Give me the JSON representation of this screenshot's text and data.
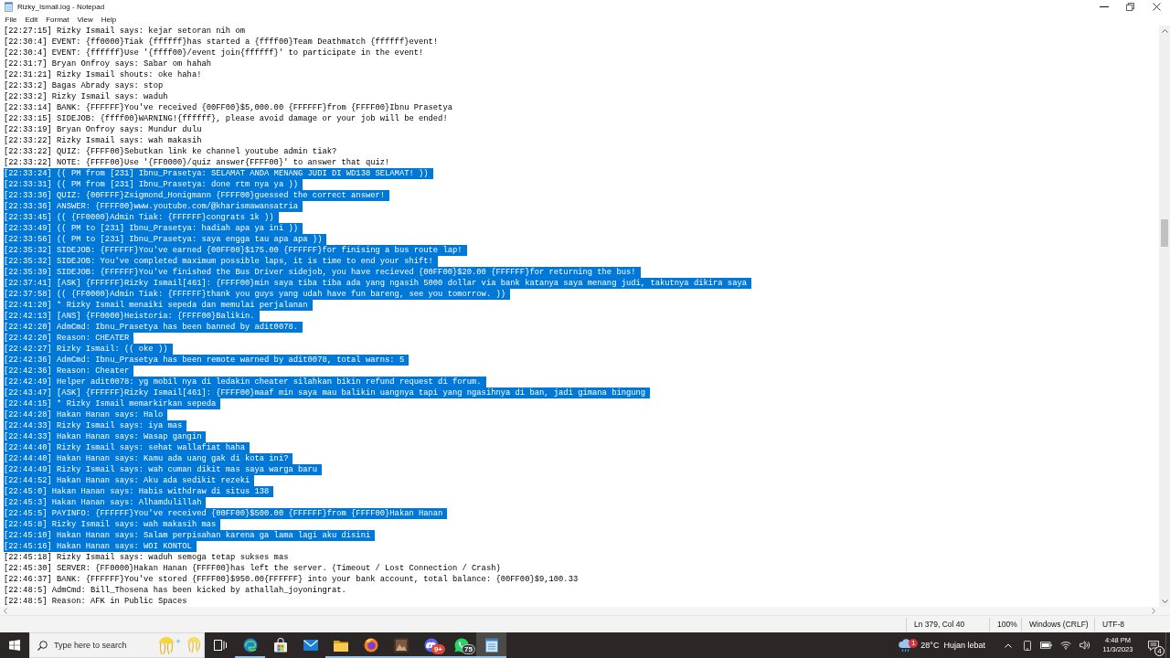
{
  "window": {
    "title": "Rizky_Ismail.log - Notepad"
  },
  "menu": [
    "File",
    "Edit",
    "Format",
    "View",
    "Help"
  ],
  "editor": {
    "lines": [
      {
        "text": "[22:27:15] Rizky Ismail says: kejar setoran nih om",
        "selected": false
      },
      {
        "text": "[22:30:4] EVENT: {ff0000}Tiak {ffffff}has started a {ffff00}Team Deathmatch {ffffff}event!",
        "selected": false
      },
      {
        "text": "[22:30:4] EVENT: {ffffff}Use '{ffff00}/event join{ffffff}' to participate in the event!",
        "selected": false
      },
      {
        "text": "[22:31:7] Bryan Onfroy says: Sabar om hahah",
        "selected": false
      },
      {
        "text": "[22:31:21] Rizky Ismail shouts: oke haha!",
        "selected": false
      },
      {
        "text": "[22:33:2] Bagas Abrady says: stop",
        "selected": false
      },
      {
        "text": "[22:33:2] Rizky Ismail says: waduh",
        "selected": false
      },
      {
        "text": "[22:33:14] BANK: {FFFFFF}You've received {00FF00}$5,000.00 {FFFFFF}from {FFFF00}Ibnu Prasetya",
        "selected": false
      },
      {
        "text": "[22:33:15] SIDEJOB: {ffff00}WARNING!{ffffff}, please avoid damage or your job will be ended!",
        "selected": false
      },
      {
        "text": "[22:33:19] Bryan Onfroy says: Mundur dulu",
        "selected": false
      },
      {
        "text": "[22:33:22] Rizky Ismail says: wah makasih",
        "selected": false
      },
      {
        "text": "[22:33:22] QUIZ: {FFFF00}Sebutkan link ke channel youtube admin tiak?",
        "selected": false
      },
      {
        "text": "[22:33:22] NOTE: {FFFF00}Use '{FF0000}/quiz answer{FFFF00}' to answer that quiz!",
        "selected": false
      },
      {
        "text": "[22:33:24] (( PM from [231] Ibnu_Prasetya: SELAMAT ANDA MENANG JUDI DI WD138 SELAMAT! ))",
        "selected": true
      },
      {
        "text": "[22:33:31] (( PM from [231] Ibnu_Prasetya: done rtm nya ya ))",
        "selected": true
      },
      {
        "text": "[22:33:36] QUIZ: {00FFFF}Zsigmond_Honigmann {FFFF00}guessed the correct answer!",
        "selected": true
      },
      {
        "text": "[22:33:36] ANSWER: {FFFF00}www.youtube.com/@kharismawansatria",
        "selected": true
      },
      {
        "text": "[22:33:45] (( {FF0000}Admin Tiak: {FFFFFF}congrats 1k ))",
        "selected": true
      },
      {
        "text": "[22:33:49] (( PM to [231] Ibnu_Prasetya: hadiah apa ya ini ))",
        "selected": true
      },
      {
        "text": "[22:33:56] (( PM to [231] Ibnu_Prasetya: saya engga tau apa apa ))",
        "selected": true
      },
      {
        "text": "[22:35:32] SIDEJOB: {FFFFFF}You've earned {00FF00}$175.00 {FFFFFF}for finising a bus route lap!",
        "selected": true
      },
      {
        "text": "[22:35:32] SIDEJOB: You've completed maximum possible laps, it is time to end your shift!",
        "selected": true
      },
      {
        "text": "[22:35:39] SIDEJOB: {FFFFFF}You've finished the Bus Driver sidejob, you have recieved {00FF00}$20.00 {FFFFFF}for returning the bus!",
        "selected": true
      },
      {
        "text": "[22:37:41] [ASK] {FFFFFF}Rizky Ismail[461]: {FFFF00}min saya tiba tiba ada yang ngasih 5000 dollar via bank katanya saya menang judi, takutnya dikira saya",
        "selected": true
      },
      {
        "text": "[22:37:58] (( {FF0000}Admin Tiak: {FFFFFF}thank you guys yang udah have fun bareng, see you tomorrow. ))",
        "selected": true
      },
      {
        "text": "[22:41:20] * Rizky Ismail menaiki sepeda dan memulai perjalanan",
        "selected": true
      },
      {
        "text": "[22:42:13] [ANS] {FF0000}Heistoria: {FFFF00}Balikin.",
        "selected": true
      },
      {
        "text": "[22:42:20] AdmCmd: Ibnu_Prasetya has been banned by adit0078.",
        "selected": true
      },
      {
        "text": "[22:42:20] Reason: CHEATER",
        "selected": true
      },
      {
        "text": "[22:42:27] Rizky Ismail: (( oke ))",
        "selected": true
      },
      {
        "text": "[22:42:36] AdmCmd: Ibnu_Prasetya has been remote warned by adit0078, total warns: 5",
        "selected": true
      },
      {
        "text": "[22:42:36] Reason: Cheater",
        "selected": true
      },
      {
        "text": "[22:42:49] Helper adit0078: yg mobil nya di ledakin cheater silahkan bikin refund request di forum.",
        "selected": true
      },
      {
        "text": "[22:43:47] [ASK] {FFFFFF}Rizky Ismail[461]: {FFFF00}maaf min saya mau balikin uangnya tapi yang ngasihnya di ban, jadi gimana bingung",
        "selected": true
      },
      {
        "text": "[22:44:15] * Rizky Ismail memarkirkan sepeda",
        "selected": true
      },
      {
        "text": "[22:44:28] Hakan Hanan says: Halo",
        "selected": true
      },
      {
        "text": "[22:44:33] Rizky Ismail says: iya mas",
        "selected": true
      },
      {
        "text": "[22:44:33] Hakan Hanan says: Wasap gangin",
        "selected": true
      },
      {
        "text": "[22:44:40] Rizky Ismail says: sehat wallafiat haha",
        "selected": true
      },
      {
        "text": "[22:44:40] Hakan Hanan says: Kamu ada uang gak di kota ini?",
        "selected": true
      },
      {
        "text": "[22:44:49] Rizky Ismail says: wah cuman dikit mas saya warga baru",
        "selected": true
      },
      {
        "text": "[22:44:52] Hakan Hanan says: Aku ada sedikit rezeki",
        "selected": true
      },
      {
        "text": "[22:45:0] Hakan Hanan says: Habis withdraw di situs 138",
        "selected": true
      },
      {
        "text": "[22:45:3] Hakan Hanan says: Alhamdulillah",
        "selected": true
      },
      {
        "text": "[22:45:5] PAYINFO: {FFFFFF}You've received {00FF00}$500.00 {FFFFFF}from {FFFF00}Hakan Hanan",
        "selected": true
      },
      {
        "text": "[22:45:8] Rizky Ismail says: wah makasih mas",
        "selected": true
      },
      {
        "text": "[22:45:10] Hakan Hanan says: Salam perpisahan karena ga lama lagi aku disini",
        "selected": true
      },
      {
        "text": "[22:45:16] Hakan Hanan says: WOI KONTOL",
        "selected": true
      },
      {
        "text": "[22:45:18] Rizky Ismail says: waduh semoga tetap sukses mas",
        "selected": false
      },
      {
        "text": "[22:45:30] SERVER: {FF0000}Hakan Hanan {FFFF00}has left the server. (Timeout / Lost Connection / Crash)",
        "selected": false
      },
      {
        "text": "[22:46:37] BANK: {FFFFFF}You've stored {FFFF00}$950.00{FFFFFF} into your bank account, total balance: {00FF00}$9,100.33",
        "selected": false
      },
      {
        "text": "[22:48:5] AdmCmd: Bill_Thosena has been kicked by athallah_joyoningrat.",
        "selected": false
      },
      {
        "text": "[22:48:5] Reason: AFK in Public Spaces",
        "selected": false
      }
    ]
  },
  "status_bar": {
    "position": "Ln 379, Col 40",
    "zoom": "100%",
    "line_ending": "Windows (CRLF)",
    "encoding": "UTF-8"
  },
  "taskbar": {
    "search": {
      "placeholder": "Type here to search"
    },
    "apps": [
      {
        "kind": "swirl",
        "running": true,
        "active": false
      },
      {
        "kind": "bag",
        "running": false,
        "active": false
      },
      {
        "kind": "envelope",
        "running": false,
        "active": false
      },
      {
        "kind": "folder",
        "running": true,
        "active": false
      },
      {
        "kind": "globe",
        "running": true,
        "active": false
      },
      {
        "kind": "tile",
        "running": true,
        "active": false
      },
      {
        "kind": "controller",
        "badge": "9+",
        "running": true,
        "active": false
      },
      {
        "kind": "chat",
        "badge": "75",
        "running": true,
        "active": false
      },
      {
        "kind": "notepad",
        "running": true,
        "active": true
      }
    ],
    "weather": {
      "badge": "1",
      "temperature": "28°C",
      "condition": "Hujan lebat"
    },
    "clock": {
      "time": "4:48 PM",
      "date": "11/3/2023"
    },
    "notifications": {
      "badge": "4"
    }
  }
}
